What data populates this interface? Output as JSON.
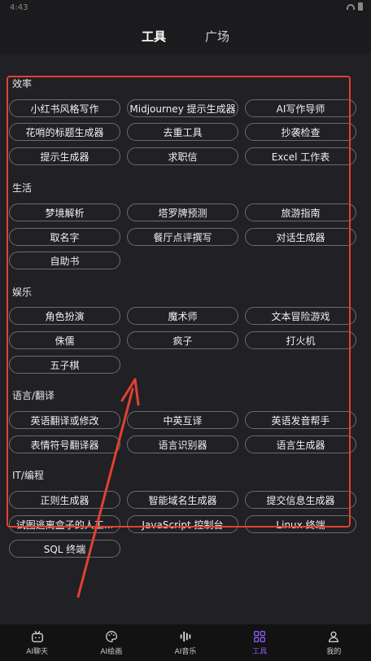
{
  "statusbar": {
    "time": "4:43"
  },
  "topnav": {
    "tabs": [
      {
        "label": "工具"
      },
      {
        "label": "广场"
      }
    ]
  },
  "sections": [
    {
      "title": "效率",
      "items": [
        "小红书风格写作",
        "Midjourney 提示生成器",
        "AI写作导师",
        "花哨的标题生成器",
        "去重工具",
        "抄袭检查",
        "提示生成器",
        "求职信",
        "Excel 工作表"
      ]
    },
    {
      "title": "生活",
      "items": [
        "梦境解析",
        "塔罗牌预测",
        "旅游指南",
        "取名字",
        "餐厅点评撰写",
        "对话生成器",
        "自助书"
      ]
    },
    {
      "title": "娱乐",
      "items": [
        "角色扮演",
        "魔术师",
        "文本冒险游戏",
        "侏儒",
        "疯子",
        "打火机",
        "五子棋"
      ]
    },
    {
      "title": "语言/翻译",
      "items": [
        "英语翻译或修改",
        "中英互译",
        "英语发音帮手",
        "表情符号翻译器",
        "语言识别器",
        "语言生成器"
      ]
    },
    {
      "title": "IT/编程",
      "items": [
        "正则生成器",
        "智能域名生成器",
        "提交信息生成器",
        "试图逃离盒子的人工...",
        "JavaScript 控制台",
        "Linux 终端",
        "SQL 终端"
      ]
    }
  ],
  "bottomnav": {
    "items": [
      {
        "label": "AI聊天",
        "icon": "tv-chat-icon"
      },
      {
        "label": "AI绘画",
        "icon": "palette-icon"
      },
      {
        "label": "AI音乐",
        "icon": "waveform-icon"
      },
      {
        "label": "工具",
        "icon": "grid-icon"
      },
      {
        "label": "我的",
        "icon": "user-icon"
      }
    ]
  },
  "colors": {
    "accent": "#8b5cf6",
    "annotation": "#e0422f"
  }
}
